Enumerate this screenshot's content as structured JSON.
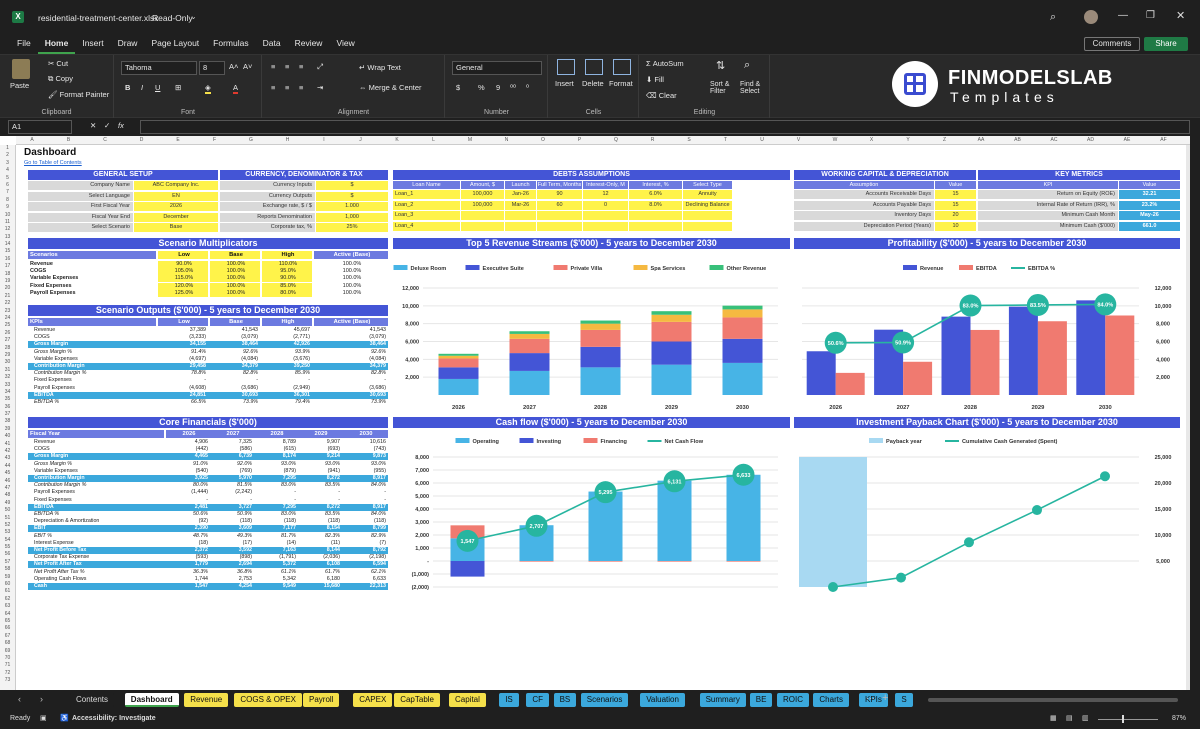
{
  "window": {
    "filename": "residential-treatment-center.xlsx",
    "mode": "Read-Only",
    "comments": "Comments",
    "share": "Share"
  },
  "menu": [
    "File",
    "Home",
    "Insert",
    "Draw",
    "Page Layout",
    "Formulas",
    "Data",
    "Review",
    "View"
  ],
  "ribbon": {
    "paste": "Paste",
    "cut": "Cut",
    "copy": "Copy",
    "format_painter": "Format Painter",
    "clipboard": "Clipboard",
    "font_name": "Tahoma",
    "font_size": "8",
    "font": "Font",
    "wrap": "Wrap Text",
    "merge": "Merge & Center",
    "alignment": "Alignment",
    "number_format": "General",
    "number": "Number",
    "insert": "Insert",
    "delete": "Delete",
    "format": "Format",
    "cells": "Cells",
    "autosum": "AutoSum",
    "fill": "Fill",
    "clear": "Clear",
    "sort": "Sort & Filter",
    "find": "Find & Select",
    "editing": "Editing"
  },
  "brand": {
    "name": "FINMODELSLAB",
    "sub": "Templates"
  },
  "formula": {
    "cellref": "A1",
    "fx": "fx"
  },
  "columns": [
    "A",
    "B",
    "C",
    "D",
    "E",
    "F",
    "G",
    "H",
    "I",
    "J",
    "K",
    "L",
    "M",
    "N",
    "O",
    "P",
    "Q",
    "R",
    "S",
    "T",
    "U",
    "V",
    "W",
    "X",
    "Y",
    "Z",
    "AA",
    "AB",
    "AC",
    "AD",
    "AE",
    "AF"
  ],
  "sheet": {
    "title": "Dashboard",
    "toc": "Go to Table of Contents"
  },
  "general": {
    "title": "GENERAL SETUP",
    "rows": [
      [
        "Company Name",
        "ABC Company Inc."
      ],
      [
        "Select Language",
        "EN"
      ],
      [
        "First Fiscal Year",
        "2026"
      ],
      [
        "Fiscal Year End",
        "December"
      ],
      [
        "Select Scenario",
        "Base"
      ]
    ]
  },
  "currency": {
    "title": "CURRENCY, DENOMINATOR & TAX",
    "rows": [
      [
        "Currency Inputs",
        "$"
      ],
      [
        "Currency Outputs",
        "$"
      ],
      [
        "Exchange rate, $ / $",
        "1.000"
      ],
      [
        "Reports Denomination",
        "1,000"
      ],
      [
        "Corporate tax, %",
        "25%"
      ]
    ]
  },
  "debts": {
    "title": "DEBTS ASSUMPTIONS",
    "headers": [
      "Loan Name",
      "Amount, $",
      "Launch",
      "Full Term, Months",
      "Interest-Only, M",
      "Interest, %",
      "Select Type"
    ],
    "rows": [
      [
        "Loan_1",
        "100,000",
        "Jan-26",
        "90",
        "12",
        "6.0%",
        "Annuity"
      ],
      [
        "Loan_2",
        "100,000",
        "Mar-26",
        "60",
        "0",
        "8.0%",
        "Declining Balance"
      ],
      [
        "Loan_3",
        "",
        "",
        "",
        "",
        "",
        ""
      ],
      [
        "Loan_4",
        "",
        "",
        "",
        "",
        "",
        ""
      ]
    ]
  },
  "wc": {
    "title": "WORKING CAPITAL & DEPRECIATION",
    "headers": [
      "Assumption",
      "Value"
    ],
    "rows": [
      [
        "Accounts Receivable Days",
        "15"
      ],
      [
        "Accounts Payable Days",
        "15"
      ],
      [
        "Inventory Days",
        "20"
      ],
      [
        "Depreciation Period (Years)",
        "10"
      ]
    ]
  },
  "kpi": {
    "title": "KEY METRICS",
    "headers": [
      "KPI",
      "Value"
    ],
    "rows": [
      [
        "Return on Equity (ROE)",
        "32.21"
      ],
      [
        "Internal Rate of Return (IRR), %",
        "23.2%"
      ],
      [
        "Minimum Cash Month",
        "May-26"
      ],
      [
        "Minimum Cash ($'000)",
        "661.0"
      ]
    ]
  },
  "multipliers": {
    "title": "Scenario Multiplicators",
    "headers": [
      "Scenarios",
      "Low",
      "Base",
      "High",
      "Active (Base)"
    ],
    "rows": [
      [
        "Revenue",
        "90.0%",
        "100.0%",
        "110.0%",
        "100.0%"
      ],
      [
        "COGS",
        "105.0%",
        "100.0%",
        "95.0%",
        "100.0%"
      ],
      [
        "Variable Expenses",
        "115.0%",
        "100.0%",
        "90.0%",
        "100.0%"
      ],
      [
        "Fixed Expenses",
        "120.0%",
        "100.0%",
        "85.0%",
        "100.0%"
      ],
      [
        "Payroll Expenses",
        "125.0%",
        "100.0%",
        "80.0%",
        "100.0%"
      ]
    ]
  },
  "outputs": {
    "title": "Scenario Outputs ($'000) - 5 years to December 2030",
    "headers": [
      "KPIs",
      "Low",
      "Base",
      "High",
      "Active (Base)"
    ],
    "rows": [
      [
        "Revenue",
        "37,389",
        "41,543",
        "45,697",
        "41,543",
        ""
      ],
      [
        "COGS",
        "(3,233)",
        "(3,079)",
        "(2,771)",
        "(3,079)",
        ""
      ],
      [
        "Gross Margin",
        "34,155",
        "38,464",
        "42,926",
        "38,464",
        "hl"
      ],
      [
        "Gross Margin %",
        "91.4%",
        "92.6%",
        "93.9%",
        "92.6%",
        "it"
      ],
      [
        "Variable Expenses",
        "(4,697)",
        "(4,084)",
        "(3,676)",
        "(4,084)",
        ""
      ],
      [
        "Contribution Margin",
        "29,458",
        "34,379",
        "39,250",
        "34,379",
        "hl"
      ],
      [
        "Contribution Margin %",
        "78.8%",
        "82.8%",
        "85.9%",
        "82.8%",
        "it"
      ],
      [
        "Fixed Expenses",
        "-",
        "-",
        "-",
        "-",
        ""
      ],
      [
        "Payroll Expenses",
        "(4,608)",
        "(3,686)",
        "(2,949)",
        "(3,686)",
        ""
      ],
      [
        "EBITDA",
        "24,851",
        "30,693",
        "36,301",
        "30,693",
        "hl"
      ],
      [
        "EBITDA %",
        "66.5%",
        "73.9%",
        "79.4%",
        "73.9%",
        "it"
      ]
    ]
  },
  "core": {
    "title": "Core Financials ($'000)",
    "headers": [
      "Fiscal Year",
      "2026",
      "2027",
      "2028",
      "2029",
      "2030"
    ],
    "rows": [
      [
        "Revenue",
        "4,906",
        "7,325",
        "8,789",
        "9,907",
        "10,616",
        ""
      ],
      [
        "COGS",
        "(442)",
        "(586)",
        "(615)",
        "(693)",
        "(743)",
        ""
      ],
      [
        "Gross Margin",
        "4,465",
        "6,739",
        "8,174",
        "9,214",
        "9,873",
        "hl"
      ],
      [
        "Gross Margin %",
        "91.0%",
        "92.0%",
        "93.0%",
        "93.0%",
        "93.0%",
        "it"
      ],
      [
        "Variable Expenses",
        "(540)",
        "(769)",
        "(879)",
        "(941)",
        "(955)",
        ""
      ],
      [
        "Contribution Margin",
        "3,925",
        "5,970",
        "7,295",
        "8,272",
        "8,917",
        "hl"
      ],
      [
        "Contribution Margin %",
        "80.0%",
        "81.5%",
        "83.0%",
        "83.5%",
        "84.0%",
        "it"
      ],
      [
        "Payroll Expenses",
        "(1,444)",
        "(2,242)",
        "-",
        "-",
        "-",
        ""
      ],
      [
        "Fixed Expenses",
        "-",
        "-",
        "-",
        "-",
        "-",
        ""
      ],
      [
        "EBITDA",
        "2,481",
        "3,727",
        "7,295",
        "8,272",
        "8,917",
        "hl"
      ],
      [
        "EBITDA %",
        "50.6%",
        "50.9%",
        "83.0%",
        "83.5%",
        "84.0%",
        "it"
      ],
      [
        "Depreciation & Amortization",
        "(92)",
        "(118)",
        "(118)",
        "(118)",
        "(118)",
        ""
      ],
      [
        "EBIT",
        "2,390",
        "3,609",
        "7,177",
        "8,154",
        "8,799",
        "hl"
      ],
      [
        "EBIT %",
        "48.7%",
        "49.3%",
        "81.7%",
        "82.3%",
        "82.9%",
        "it"
      ],
      [
        "Interest Expense",
        "(18)",
        "(17)",
        "(14)",
        "(11)",
        "(7)",
        ""
      ],
      [
        "Net Profit Before Tax",
        "2,372",
        "3,592",
        "7,163",
        "8,144",
        "8,792",
        "hl"
      ],
      [
        "Corporate Tax Expense",
        "(593)",
        "(898)",
        "(1,791)",
        "(2,036)",
        "(2,198)",
        ""
      ],
      [
        "Net Profit After Tax",
        "1,779",
        "2,694",
        "5,372",
        "6,108",
        "6,594",
        "hl"
      ],
      [
        "Net Profit After Tax %",
        "36.3%",
        "36.8%",
        "61.1%",
        "61.7%",
        "62.1%",
        "it"
      ],
      [
        "Operating Cash Flows",
        "1,744",
        "2,753",
        "5,342",
        "6,180",
        "6,633",
        ""
      ],
      [
        "Cash",
        "1,547",
        "4,254",
        "9,549",
        "15,680",
        "22,313",
        "hl"
      ]
    ]
  },
  "chart_data": [
    {
      "type": "bar",
      "title": "Top 5 Revenue Streams ($'000) - 5 years to December 2030",
      "categories": [
        "2026",
        "2027",
        "2028",
        "2029",
        "2030"
      ],
      "ylim": [
        0,
        12000
      ],
      "yticks": [
        "2,000",
        "4,000",
        "6,000",
        "8,000",
        "10,000",
        "12,000"
      ],
      "series": [
        {
          "name": "Deluxe Room",
          "color": "#47b4e6",
          "values": [
            1800,
            2700,
            3100,
            3400,
            3600
          ]
        },
        {
          "name": "Executive Suite",
          "color": "#4455d6",
          "values": [
            1300,
            2000,
            2300,
            2600,
            2700
          ]
        },
        {
          "name": "Private Villa",
          "color": "#f07a70",
          "values": [
            1000,
            1600,
            1900,
            2200,
            2400
          ]
        },
        {
          "name": "Spa Services",
          "color": "#f5b941",
          "values": [
            300,
            550,
            700,
            800,
            900
          ]
        },
        {
          "name": "Other Revenue",
          "color": "#38c07a",
          "values": [
            220,
            300,
            350,
            400,
            420
          ]
        }
      ]
    },
    {
      "type": "bar",
      "title": "Profitability ($'000) - 5 years to December 2030",
      "categories": [
        "2026",
        "2027",
        "2028",
        "2029",
        "2030"
      ],
      "ylim": [
        0,
        12000
      ],
      "yticks": [
        "2,000",
        "4,000",
        "6,000",
        "8,000",
        "10,000",
        "12,000"
      ],
      "series": [
        {
          "name": "Revenue",
          "color": "#4455d6",
          "values": [
            4906,
            7325,
            8789,
            9907,
            10616
          ]
        },
        {
          "name": "EBITDA",
          "color": "#f07a70",
          "values": [
            2481,
            3727,
            7295,
            8272,
            8917
          ]
        }
      ],
      "line": {
        "name": "EBITDA %",
        "color": "#27b5a0",
        "values": [
          50.6,
          50.9,
          83.0,
          83.5,
          84.0
        ],
        "labels": [
          "50.6%",
          "50.9%",
          "83.0%",
          "83.5%",
          "84.0%"
        ]
      }
    },
    {
      "type": "bar",
      "title": "Cash flow ($'000) - 5 years to December 2030",
      "categories": [
        "2026",
        "2027",
        "2028",
        "2029",
        "2030"
      ],
      "ylim": [
        -2000,
        8000
      ],
      "yticks": [
        "(2,000)",
        "(1,000)",
        "-",
        "1,000",
        "2,000",
        "3,000",
        "4,000",
        "5,000",
        "6,000",
        "7,000",
        "8,000"
      ],
      "series": [
        {
          "name": "Operating",
          "color": "#47b4e6",
          "values": [
            1744,
            2753,
            5342,
            6180,
            6633
          ]
        },
        {
          "name": "Investing",
          "color": "#4455d6",
          "values": [
            -1200,
            0,
            0,
            0,
            0
          ]
        },
        {
          "name": "Financing",
          "color": "#f07a70",
          "values": [
            1000,
            -50,
            -50,
            -50,
            -50
          ]
        }
      ],
      "line": {
        "name": "Net Cash Flow",
        "color": "#27b5a0",
        "values": [
          1547,
          2707,
          5295,
          6131,
          6633
        ],
        "labels": [
          "1,547",
          "2,707",
          "5,295",
          "6,131",
          "6,633"
        ]
      }
    },
    {
      "type": "line",
      "title": "Investment Payback Chart ($'000) - 5 years to December 2030",
      "categories": [
        "2026",
        "2027",
        "2028",
        "2029",
        "2030"
      ],
      "ylim": [
        0,
        25000
      ],
      "yticks": [
        "5,000",
        "10,000",
        "15,000",
        "20,000",
        "25,000"
      ],
      "payback": {
        "name": "Payback year",
        "color": "#a8d9f2",
        "index": 0
      },
      "line": {
        "name": "Cumulative Cash Generated (Spent)",
        "color": "#27b5a0",
        "values": [
          0,
          1800,
          8600,
          14800,
          21300
        ]
      }
    }
  ],
  "tabs": [
    {
      "label": "Contents",
      "bg": "#1f1f1f",
      "fg": "#ddd"
    },
    {
      "label": "Dashboard",
      "bg": "#ffffff",
      "fg": "#111"
    },
    {
      "label": "Revenue",
      "bg": "#f5e04a",
      "fg": "#111"
    },
    {
      "label": "COGS & OPEX",
      "bg": "#f5e04a",
      "fg": "#111"
    },
    {
      "label": "Payroll",
      "bg": "#f5e04a",
      "fg": "#111"
    },
    {
      "label": "CAPEX",
      "bg": "#f5e04a",
      "fg": "#111"
    },
    {
      "label": "CapTable",
      "bg": "#f5e04a",
      "fg": "#111"
    },
    {
      "label": "Capital",
      "bg": "#f5e04a",
      "fg": "#111"
    },
    {
      "label": "IS",
      "bg": "#3ba8dc",
      "fg": "#111"
    },
    {
      "label": "CF",
      "bg": "#3ba8dc",
      "fg": "#111"
    },
    {
      "label": "BS",
      "bg": "#3ba8dc",
      "fg": "#111"
    },
    {
      "label": "Scenarios",
      "bg": "#3ba8dc",
      "fg": "#111"
    },
    {
      "label": "Valuation",
      "bg": "#3ba8dc",
      "fg": "#111"
    },
    {
      "label": "Summary",
      "bg": "#3ba8dc",
      "fg": "#111"
    },
    {
      "label": "BE",
      "bg": "#3ba8dc",
      "fg": "#111"
    },
    {
      "label": "ROIC",
      "bg": "#3ba8dc",
      "fg": "#111"
    },
    {
      "label": "Charts",
      "bg": "#3ba8dc",
      "fg": "#111"
    },
    {
      "label": "KPIs",
      "bg": "#3ba8dc",
      "fg": "#111"
    },
    {
      "label": "S",
      "bg": "#3ba8dc",
      "fg": "#111"
    }
  ],
  "status": {
    "ready": "Ready",
    "accessibility": "Accessibility: Investigate",
    "zoom": "87%"
  }
}
